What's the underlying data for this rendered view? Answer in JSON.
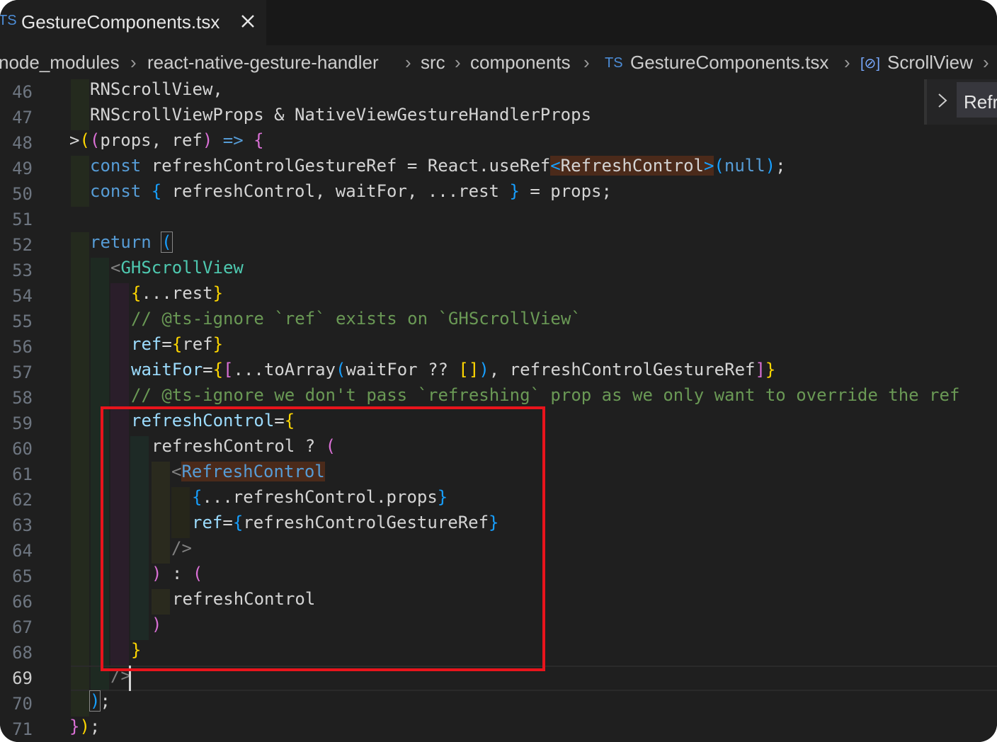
{
  "tab": {
    "icon_label": "TS",
    "title": "GestureComponents.tsx",
    "close_icon": "close-icon"
  },
  "breadcrumbs": {
    "items": [
      "node_modules",
      "react-native-gesture-handler",
      "src",
      "components",
      "GestureComponents.tsx",
      "ScrollView"
    ],
    "file_icon_label": "TS",
    "symbol_icon_label": "[⊘]"
  },
  "sticky_scroll": {
    "label": "Refr"
  },
  "editor": {
    "active_line": 69,
    "line_numbers": [
      "46",
      "47",
      "48",
      "49",
      "50",
      "51",
      "52",
      "53",
      "54",
      "55",
      "56",
      "57",
      "58",
      "59",
      "60",
      "61",
      "62",
      "63",
      "64",
      "65",
      "66",
      "67",
      "68",
      "69",
      "70",
      "71"
    ],
    "tokens": {
      "l46": "RNScrollView,",
      "l47": "RNScrollViewProps & NativeViewGestureHandlerProps",
      "l48_a": ">",
      "l48_b": "(",
      "l48_c": "(",
      "l48_d": "props, ref",
      "l48_e": ")",
      "l48_f": " => ",
      "l48_g": "{",
      "l49_kw": "const",
      "l49_a": " refreshControlGestureRef = React.useRef",
      "l49_b": "<",
      "l49_c": "RefreshControl",
      "l49_d": ">",
      "l49_e": "(",
      "l49_f": "null",
      "l49_g": ")",
      "l49_h": ";",
      "l50_kw": "const",
      "l50_a": " ",
      "l50_b": "{",
      "l50_c": " refreshControl, waitFor, ...rest ",
      "l50_d": "}",
      "l50_e": " = props;",
      "l52_kw": "return",
      "l52_a": " ",
      "l52_b": "(",
      "l53_a": "<",
      "l53_b": "GHScrollView",
      "l54_a": "{",
      "l54_b": "...rest",
      "l54_c": "}",
      "l55": "// @ts-ignore `ref` exists on `GHScrollView`",
      "l56_a": "ref",
      "l56_b": "=",
      "l56_c": "{",
      "l56_d": "ref",
      "l56_e": "}",
      "l57_a": "waitFor",
      "l57_b": "=",
      "l57_c": "{",
      "l57_d": "[",
      "l57_e": "...toArray",
      "l57_f": "(",
      "l57_g": "waitFor ?? ",
      "l57_h": "[]",
      "l57_i": ")",
      "l57_j": ", refreshControlGestureRef",
      "l57_k": "]",
      "l57_l": "}",
      "l58": "// @ts-ignore we don't pass `refreshing` prop as we only want to override the ref",
      "l59_a": "refreshControl",
      "l59_b": "=",
      "l59_c": "{",
      "l60_a": "refreshControl ? ",
      "l60_b": "(",
      "l61_a": "<",
      "l61_b": "RefreshControl",
      "l62_a": "{",
      "l62_b": "...refreshControl.props",
      "l62_c": "}",
      "l63_a": "ref",
      "l63_b": "=",
      "l63_c": "{",
      "l63_d": "refreshControlGestureRef",
      "l63_e": "}",
      "l64": "/>",
      "l65_a": ")",
      "l65_b": " : ",
      "l65_c": "(",
      "l66": "refreshControl",
      "l67": ")",
      "l68": "}",
      "l69": "/>",
      "l70_a": ")",
      "l70_b": ";",
      "l71_a": "}",
      "l71_b": ")",
      "l71_c": ";"
    }
  }
}
